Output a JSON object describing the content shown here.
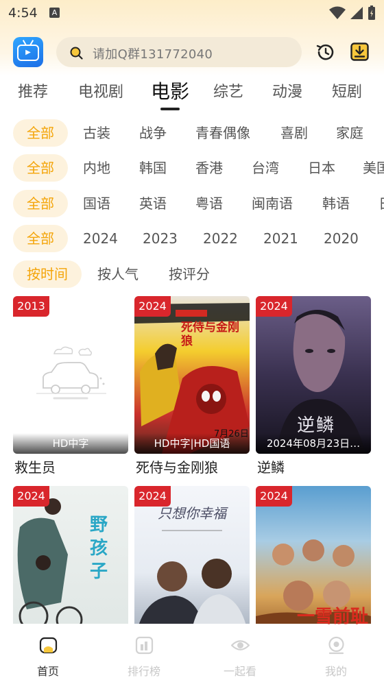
{
  "status_bar": {
    "time": "4:54",
    "notif_badge": "A"
  },
  "search": {
    "placeholder": "请加Q群131772040"
  },
  "tabs": [
    "推荐",
    "电视剧",
    "电影",
    "综艺",
    "动漫",
    "短剧"
  ],
  "filters": {
    "genre": [
      "全部",
      "古装",
      "战争",
      "青春偶像",
      "喜剧",
      "家庭"
    ],
    "region": [
      "全部",
      "内地",
      "韩国",
      "香港",
      "台湾",
      "日本",
      "美国"
    ],
    "language": [
      "全部",
      "国语",
      "英语",
      "粤语",
      "闽南语",
      "韩语",
      "日"
    ],
    "year": [
      "全部",
      "2024",
      "2023",
      "2022",
      "2021",
      "2020"
    ],
    "sort": [
      "按时间",
      "按人气",
      "按评分"
    ]
  },
  "movies": [
    {
      "year": "2013",
      "caption": "HD中字",
      "title": "救生员"
    },
    {
      "year": "2024",
      "caption": "HD中字|HD国语",
      "title": "死侍与金刚狼",
      "poster_text": "死侍与金刚狼",
      "poster_date": "7月26日"
    },
    {
      "year": "2024",
      "caption": "2024年08月23日…",
      "title": "逆鳞",
      "poster_text": "逆鳞"
    },
    {
      "year": "2024",
      "caption": "",
      "title": "",
      "poster_text": "野孩子"
    },
    {
      "year": "2024",
      "caption": "",
      "title": "",
      "poster_text": "只想你幸福"
    },
    {
      "year": "2024",
      "caption": "",
      "title": "",
      "poster_text": "一雪前耻"
    }
  ],
  "bottom_nav": [
    "首页",
    "排行榜",
    "一起看",
    "我的"
  ],
  "colors": {
    "accent": "#f4a50a",
    "badge": "#d9262c",
    "chip_bg": "#fdf2dd"
  }
}
